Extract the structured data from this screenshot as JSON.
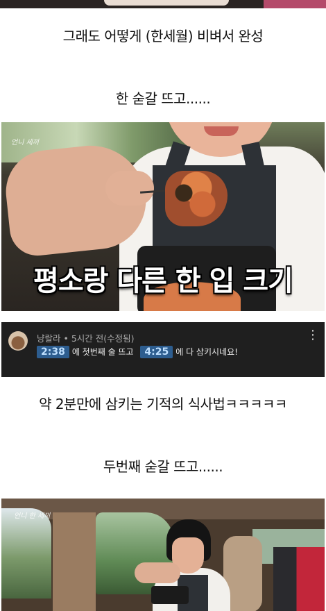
{
  "captions": {
    "c1": "그래도 어떻게 (한세월) 비벼서 완성",
    "c2": "한 숟갈 뜨고......",
    "c3": "약 2분만에 삼키는 기적의 식사법ㅋㅋㅋㅋㅋ",
    "c4": "두번째 숟갈 뜨고......"
  },
  "photo1": {
    "logo": "언니 세끼",
    "overlay": "평소랑 다른 한 입 크기"
  },
  "comment": {
    "author": "냥랄라",
    "separator": "•",
    "time": "5시간 전(수정됨)",
    "ts1": "2:38",
    "text1": "에 첫번째 술 뜨고",
    "ts2": "4:25",
    "text2": "에 다 삼키시네요!",
    "more": "⋮"
  },
  "photo2": {
    "logo": "언니 한 세끼"
  }
}
